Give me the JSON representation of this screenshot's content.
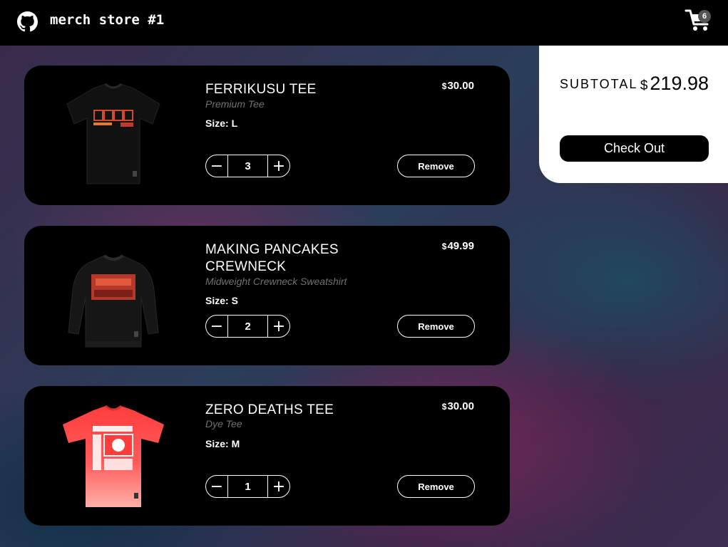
{
  "header": {
    "brand": "merch store #1",
    "cart_count": "6",
    "cart_icon": "cart-icon",
    "logo_icon": "github-logo-icon"
  },
  "colors": {
    "header_bg": "#000000",
    "card_bg": "#000000",
    "item3_shirt": "#ff4b4b"
  },
  "items": [
    {
      "name": "FERRIKUSU TEE",
      "subtitle": "Premium Tee",
      "size_label": "Size:",
      "size": "L",
      "currency": "$",
      "price": "30.00",
      "quantity": "3",
      "minus": "−",
      "plus": "+",
      "remove": "Remove"
    },
    {
      "name": "MAKING PANCAKES CREWNECK",
      "subtitle": "Midweight Crewneck Sweatshirt",
      "size_label": "Size:",
      "size": "S",
      "currency": "$",
      "price": "49.99",
      "quantity": "2",
      "minus": "−",
      "plus": "+",
      "remove": "Remove"
    },
    {
      "name": "ZERO DEATHS TEE",
      "subtitle": "Dye Tee",
      "size_label": "Size:",
      "size": "M",
      "currency": "$",
      "price": "30.00",
      "quantity": "1",
      "minus": "−",
      "plus": "+",
      "remove": "Remove"
    }
  ],
  "summary": {
    "label": "SUBTOTAL",
    "currency": "$",
    "total": "219.98",
    "checkout": "Check Out"
  }
}
